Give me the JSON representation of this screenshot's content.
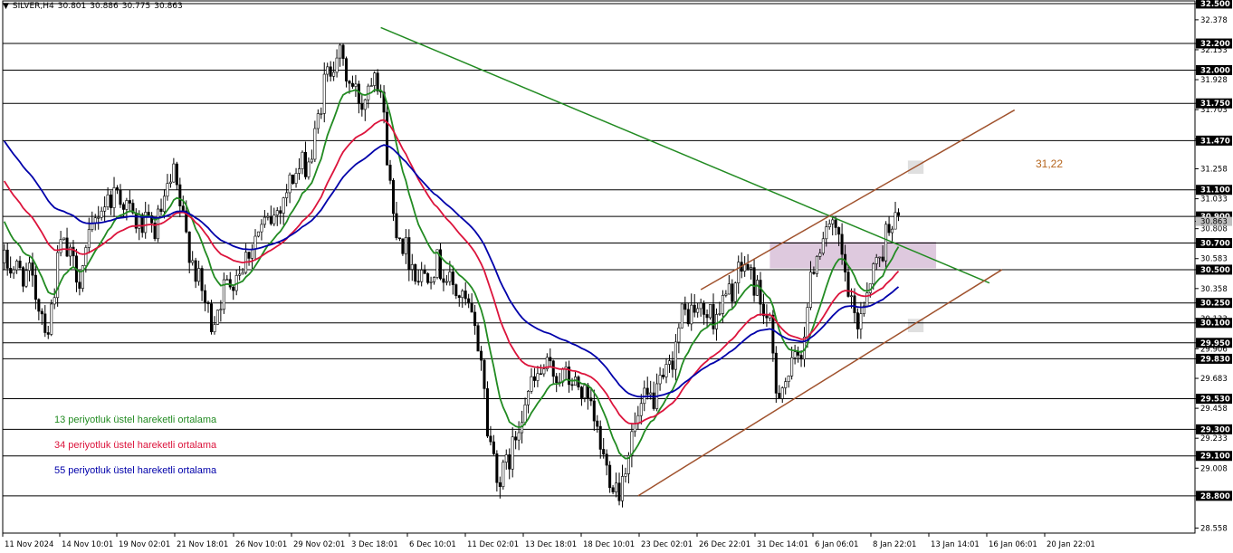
{
  "header": {
    "symbol": "SILVER,H4",
    "open": "30.801",
    "high": "30.886",
    "low": "30.775",
    "close": "30.863"
  },
  "legend": [
    {
      "label": "13 periyotluk üstel hareketli ortalama",
      "color": "#228b22"
    },
    {
      "label": "34 periyotluk üstel hareketli ortalama",
      "color": "#dc143c"
    },
    {
      "label": "55 periyotluk üstel hareketli ortalama",
      "color": "#0000aa"
    }
  ],
  "annotation": {
    "text": "31,22",
    "value": 31.22
  },
  "chart_data": {
    "type": "candlestick",
    "title": "SILVER,H4",
    "ylim": [
      28.52,
      32.52
    ],
    "bar_count": 380,
    "y_ticks": [
      "28.558",
      "28.800",
      "29.008",
      "29.100",
      "29.233",
      "29.300",
      "29.458",
      "29.530",
      "29.683",
      "29.830",
      "29.906",
      "29.950",
      "30.100",
      "30.133",
      "30.250",
      "30.358",
      "30.500",
      "30.583",
      "30.700",
      "30.808",
      "30.863",
      "30.900",
      "31.033",
      "31.100",
      "31.258",
      "31.470",
      "31.483",
      "31.703",
      "31.750",
      "31.928",
      "32.000",
      "32.153",
      "32.200",
      "32.378",
      "32.500"
    ],
    "x_labels": [
      "11 Nov 2024",
      "14 Nov 10:01",
      "19 Nov 02:01",
      "21 Nov 18:01",
      "26 Nov 10:01",
      "29 Nov 02:01",
      "3 Dec 18:01",
      "6 Dec 10:01",
      "11 Dec 02:01",
      "13 Dec 18:01",
      "18 Dec 10:01",
      "23 Dec 02:01",
      "26 Dec 22:01",
      "31 Dec 14:01",
      "6 Jan 06:01",
      "8 Jan 22:01",
      "13 Jan 14:01",
      "16 Jan 06:01",
      "20 Jan 22:01"
    ],
    "horizontal_levels": [
      {
        "value": 32.5,
        "label": "32.500"
      },
      {
        "value": 32.2,
        "label": "32.200"
      },
      {
        "value": 32.0,
        "label": "32.000"
      },
      {
        "value": 31.75,
        "label": "31.750"
      },
      {
        "value": 31.47,
        "label": "31.470"
      },
      {
        "value": 31.1,
        "label": "31.100"
      },
      {
        "value": 30.9,
        "label": "30.900"
      },
      {
        "value": 30.7,
        "label": "30.700"
      },
      {
        "value": 30.5,
        "label": "30.500"
      },
      {
        "value": 30.25,
        "label": "30.250"
      },
      {
        "value": 30.1,
        "label": "30.100"
      },
      {
        "value": 29.95,
        "label": "29.950"
      },
      {
        "value": 29.83,
        "label": "29.830"
      },
      {
        "value": 29.53,
        "label": "29.530"
      },
      {
        "value": 29.3,
        "label": "29.300"
      },
      {
        "value": 29.1,
        "label": "29.100"
      },
      {
        "value": 28.8,
        "label": "28.800"
      }
    ],
    "current_price": {
      "value": 30.863,
      "label": "30.863"
    },
    "price_path": [
      [
        0,
        30.55
      ],
      [
        8,
        30.45
      ],
      [
        14,
        30.05
      ],
      [
        18,
        30.7
      ],
      [
        24,
        30.45
      ],
      [
        30,
        30.95
      ],
      [
        36,
        31.1
      ],
      [
        42,
        30.85
      ],
      [
        48,
        30.8
      ],
      [
        54,
        31.2
      ],
      [
        58,
        30.75
      ],
      [
        62,
        30.4
      ],
      [
        66,
        30.1
      ],
      [
        70,
        30.35
      ],
      [
        76,
        30.55
      ],
      [
        80,
        30.75
      ],
      [
        86,
        30.9
      ],
      [
        92,
        31.2
      ],
      [
        98,
        31.35
      ],
      [
        102,
        31.9
      ],
      [
        106,
        32.15
      ],
      [
        110,
        31.9
      ],
      [
        114,
        31.75
      ],
      [
        118,
        32.05
      ],
      [
        120,
        31.85
      ],
      [
        124,
        30.9
      ],
      [
        128,
        30.65
      ],
      [
        132,
        30.45
      ],
      [
        138,
        30.55
      ],
      [
        142,
        30.4
      ],
      [
        148,
        30.2
      ],
      [
        152,
        29.85
      ],
      [
        154,
        29.3
      ],
      [
        158,
        28.9
      ],
      [
        162,
        29.15
      ],
      [
        166,
        29.55
      ],
      [
        172,
        29.75
      ],
      [
        178,
        29.7
      ],
      [
        184,
        29.6
      ],
      [
        188,
        29.35
      ],
      [
        192,
        29.0
      ],
      [
        196,
        28.85
      ],
      [
        200,
        29.25
      ],
      [
        204,
        29.5
      ],
      [
        208,
        29.55
      ],
      [
        212,
        29.75
      ],
      [
        216,
        30.15
      ],
      [
        220,
        30.2
      ],
      [
        226,
        30.15
      ],
      [
        232,
        30.35
      ],
      [
        236,
        30.55
      ],
      [
        240,
        30.35
      ],
      [
        244,
        30.05
      ],
      [
        246,
        29.6
      ],
      [
        250,
        29.7
      ],
      [
        254,
        29.9
      ],
      [
        258,
        30.55
      ],
      [
        262,
        30.85
      ],
      [
        266,
        30.7
      ],
      [
        270,
        30.2
      ],
      [
        272,
        30.1
      ],
      [
        276,
        30.45
      ],
      [
        280,
        30.65
      ],
      [
        282,
        30.88
      ],
      [
        285,
        30.86
      ]
    ],
    "trendlines": [
      {
        "name": "green-resistance",
        "color": "#228b22",
        "from": [
          120,
          32.32
        ],
        "to": [
          314,
          30.4
        ]
      },
      {
        "name": "channel-upper",
        "color": "#a0522d",
        "from": [
          222,
          30.35
        ],
        "to": [
          322,
          31.7
        ]
      },
      {
        "name": "channel-lower",
        "color": "#a0522d",
        "from": [
          202,
          28.8
        ],
        "to": [
          318,
          30.5
        ]
      }
    ],
    "zones": [
      {
        "name": "purple-zone",
        "color": "#d8bfd8",
        "x": [
          244,
          297
        ],
        "y": [
          30.51,
          30.71
        ]
      },
      {
        "name": "target-zone-upper",
        "color": "#d9d9d9",
        "x": [
          288,
          293
        ],
        "y": [
          31.22,
          31.32
        ]
      },
      {
        "name": "target-zone-lower",
        "color": "#d9d9d9",
        "x": [
          288,
          293
        ],
        "y": [
          30.03,
          30.13
        ]
      }
    ],
    "ma_lines": [
      {
        "name": "EMA 13",
        "color": "#228b22",
        "period": 13
      },
      {
        "name": "EMA 34",
        "color": "#dc143c",
        "period": 34
      },
      {
        "name": "EMA 55",
        "color": "#0000aa",
        "period": 55
      }
    ]
  }
}
